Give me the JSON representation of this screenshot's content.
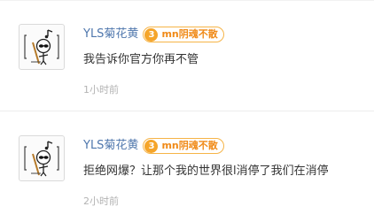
{
  "comments": [
    {
      "username": "YLS菊花黄",
      "badge": {
        "level": "3",
        "name": "mn阴魂不散"
      },
      "text": "我告诉你官方你再不管",
      "time": "1小时前",
      "avatar_icon": "cartoon-sunglasses-character-icon"
    },
    {
      "username": "YLS菊花黄",
      "badge": {
        "level": "3",
        "name": "mn阴魂不散"
      },
      "text": "拒绝网爆？让那个我的世界很l消停了我们在消停",
      "time": "2小时前",
      "avatar_icon": "cartoon-sunglasses-character-icon"
    }
  ],
  "colors": {
    "username": "#4f77ad",
    "badge_accent": "#f5a52a",
    "badge_text": "#f08a18",
    "body_text": "#333333",
    "timestamp": "#b3b3b3"
  }
}
